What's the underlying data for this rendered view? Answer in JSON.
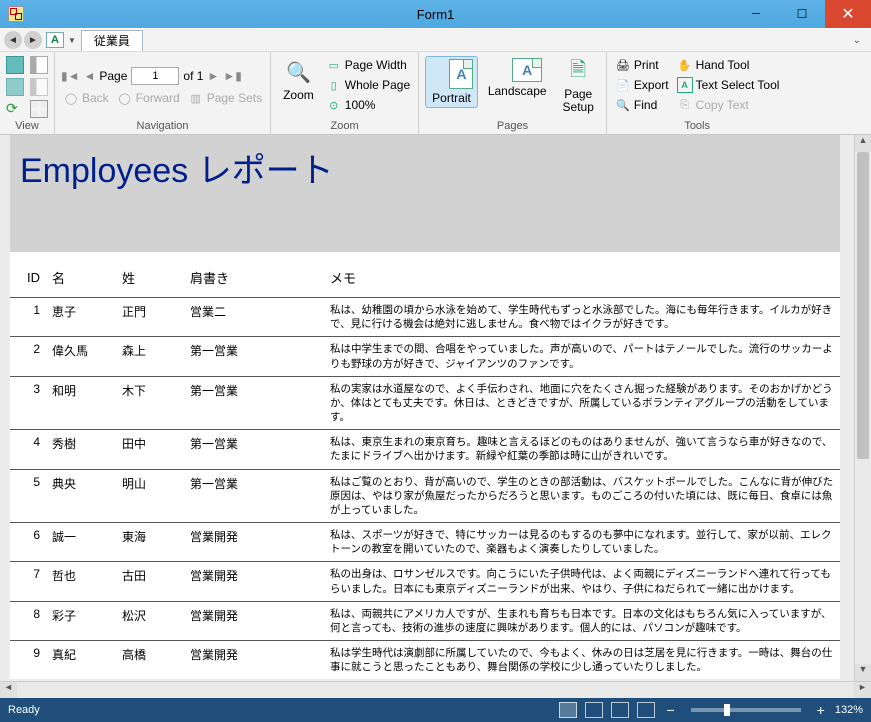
{
  "window": {
    "title": "Form1"
  },
  "breadcrumb": {
    "tab_label": "従業員"
  },
  "ribbon": {
    "view_group": "View",
    "navigation_group": "Navigation",
    "zoom_group": "Zoom",
    "pages_group": "Pages",
    "tools_group": "Tools",
    "page_word": "Page",
    "page_current": "1",
    "page_of": "of 1",
    "back": "Back",
    "forward": "Forward",
    "page_sets": "Page Sets",
    "zoom": "Zoom",
    "page_width": "Page Width",
    "whole_page": "Whole Page",
    "hundred": "100%",
    "portrait": "Portrait",
    "landscape": "Landscape",
    "page_setup": "Page\nSetup",
    "print": "Print",
    "export": "Export",
    "find": "Find",
    "hand_tool": "Hand Tool",
    "text_select": "Text Select Tool",
    "copy_text": "Copy Text"
  },
  "report": {
    "title": "Employees レポート",
    "columns": {
      "id": "ID",
      "first": "名",
      "last": "姓",
      "title": "肩書き",
      "memo": "メモ"
    },
    "rows": [
      {
        "id": "1",
        "first": "恵子",
        "last": "正門",
        "title": "営業二",
        "memo": "私は、幼稚園の頃から水泳を始めて、学生時代もずっと水泳部でした。海にも毎年行きます。イルカが好きで、見に行ける機会は絶対に逃しません。食べ物ではイクラが好きです。"
      },
      {
        "id": "2",
        "first": "偉久馬",
        "last": "森上",
        "title": "第一営業",
        "memo": "私は中学生までの間、合唱をやっていました。声が高いので、パートはテノールでした。流行のサッカーよりも野球の方が好きで、ジャイアンツのファンです。"
      },
      {
        "id": "3",
        "first": "和明",
        "last": "木下",
        "title": "第一営業",
        "memo": "私の実家は水道屋なので、よく手伝わされ、地面に穴をたくさん掘った経験があります。そのおかげかどうか、体はとても丈夫です。休日は、ときどきですが、所属しているボランティアグループの活動をしています。"
      },
      {
        "id": "4",
        "first": "秀樹",
        "last": "田中",
        "title": "第一営業",
        "memo": "私は、東京生まれの東京育ち。趣味と言えるほどのものはありませんが、強いて言うなら車が好きなので、たまにドライブへ出かけます。新緑や紅葉の季節は時に山がきれいです。"
      },
      {
        "id": "5",
        "first": "典央",
        "last": "明山",
        "title": "第一営業",
        "memo": "私はご覧のとおり、背が高いので、学生のときの部活動は、バスケットボールでした。こんなに背が伸びた原因は、やはり家が魚屋だったからだろうと思います。ものごころの付いた頃には、既に毎日、食卓には魚が上っていました。"
      },
      {
        "id": "6",
        "first": "誠一",
        "last": "東海",
        "title": "営業開発",
        "memo": "私は、スポーツが好きで、特にサッカーは見るのもするのも夢中になれます。並行して、家が以前、エレクトーンの教室を開いていたので、楽器もよく演奏したりしていました。"
      },
      {
        "id": "7",
        "first": "哲也",
        "last": "古田",
        "title": "営業開発",
        "memo": "私の出身は、ロサンゼルスです。向こうにいた子供時代は、よく両親にディズニーランドへ連れて行ってもらいました。日本にも東京ディズニーランドが出来、やはり、子供にねだられて一緒に出かけます。"
      },
      {
        "id": "8",
        "first": "彩子",
        "last": "松沢",
        "title": "営業開発",
        "memo": "私は、両親共にアメリカ人ですが、生まれも育ちも日本です。日本の文化はもちろん気に入っていますが、何と言っても、技術の進歩の速度に興味があります。個人的には、パソコンが趣味です。"
      },
      {
        "id": "9",
        "first": "真紀",
        "last": "高橋",
        "title": "営業開発",
        "memo": "私は学生時代は演劇部に所属していたので、今もよく、休みの日は芝居を見に行きます。一時は、舞台の仕事に就こうと思ったこともあり、舞台関係の学校に少し通っていたりしました。"
      }
    ]
  },
  "status": {
    "ready": "Ready",
    "zoom": "132%"
  }
}
